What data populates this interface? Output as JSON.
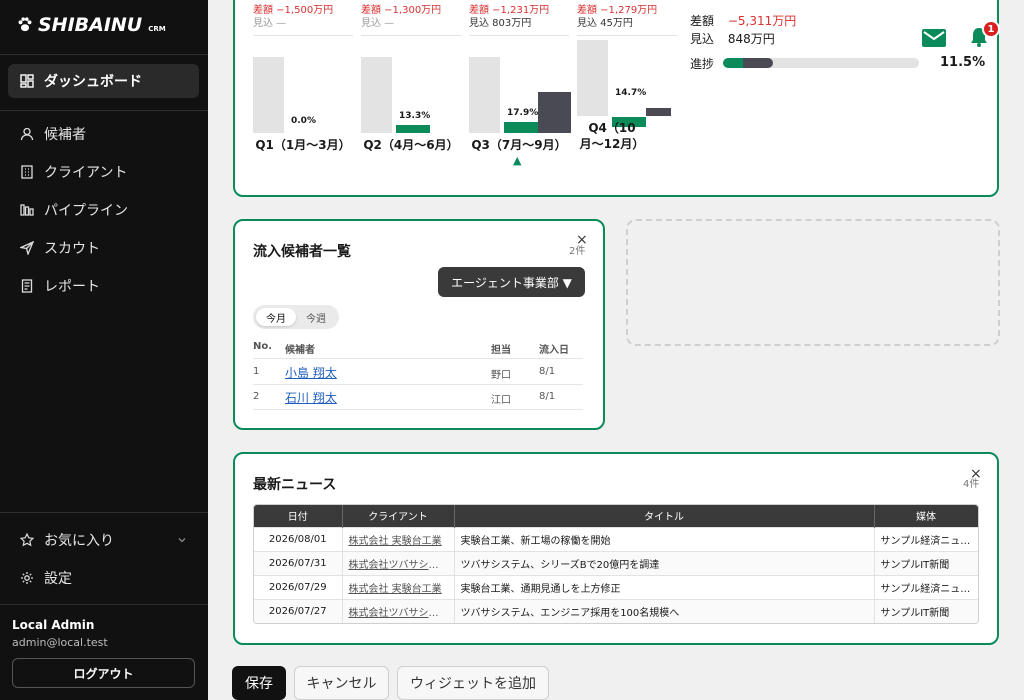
{
  "app": {
    "logo_text": "SHIBAINU",
    "logo_sub": "CRM"
  },
  "sidebar": {
    "items": [
      {
        "label": "ダッシュボード",
        "icon": "dashboard-icon",
        "active": true
      },
      {
        "label": "候補者",
        "icon": "person-icon"
      },
      {
        "label": "クライアント",
        "icon": "building-icon"
      },
      {
        "label": "パイプライン",
        "icon": "pipeline-icon"
      },
      {
        "label": "スカウト",
        "icon": "send-icon"
      },
      {
        "label": "レポート",
        "icon": "report-icon"
      }
    ],
    "favorites_label": "お気に入り",
    "settings_label": "設定",
    "user": {
      "name": "Local Admin",
      "email": "admin@local.test"
    },
    "logout_label": "ログアウト"
  },
  "sales": {
    "quarters": [
      {
        "top_red": "差額 −1,500万円",
        "forecast": "見込 —",
        "forecast_muted": true,
        "pct": "0.0%",
        "actual": 0.0,
        "has_forecast_bar": false,
        "label": "Q1（1月〜3月）",
        "current": false
      },
      {
        "top_red": "差額 −1,300万円",
        "forecast": "見込 —",
        "forecast_muted": true,
        "pct": "13.3%",
        "actual": 0.133,
        "has_forecast_bar": false,
        "label": "Q2（4月〜6月）",
        "current": false
      },
      {
        "top_red": "差額 −1,231万円",
        "forecast": "見込 803万円",
        "forecast_muted": false,
        "pct": "17.9%",
        "actual": 0.179,
        "has_forecast_bar": true,
        "label": "Q3（7月〜9月）",
        "current": true
      },
      {
        "top_red": "差額 −1,279万円",
        "forecast": "見込 45万円",
        "forecast_muted": false,
        "pct": "14.7%",
        "actual": 0.147,
        "has_forecast_bar": true,
        "label": "Q4（10月〜12月）",
        "current": false
      }
    ],
    "current_marker": "▲",
    "summary": {
      "diff_label": "差額",
      "diff_value": "−5,311万円",
      "forecast_label": "見込",
      "forecast_value": "848万円",
      "progress_label": "進捗",
      "progress_value": "11.5%",
      "progress": 0.115
    },
    "notification_count": "1",
    "colors": {
      "accent": "#0b8a5a",
      "negative": "#d93030",
      "forecast": "#4a4a55"
    }
  },
  "inflow": {
    "title": "流入候補者一覧",
    "count": "2件",
    "department": "エージェント事業部 ▼",
    "tabs": [
      "今月",
      "今週"
    ],
    "headers": [
      "No.",
      "候補者",
      "担当",
      "流入日"
    ],
    "rows": [
      {
        "no": "1",
        "name": "小島 翔太",
        "owner": "野口",
        "date": "8/1"
      },
      {
        "no": "2",
        "name": "石川 翔太",
        "owner": "江口",
        "date": "8/1"
      }
    ]
  },
  "news": {
    "title": "最新ニュース",
    "count": "4件",
    "headers": [
      "日付",
      "クライアント",
      "タイトル",
      "媒体"
    ],
    "rows": [
      {
        "date": "2026/08/01",
        "client": "株式会社 実験台工業",
        "title": "実験台工業、新工場の稼働を開始",
        "media": "サンプル経済ニュース"
      },
      {
        "date": "2026/07/31",
        "client": "株式会社ツバサシステム",
        "title": "ツバサシステム、シリーズBで20億円を調達",
        "media": "サンプルIT新聞"
      },
      {
        "date": "2026/07/29",
        "client": "株式会社 実験台工業",
        "title": "実験台工業、通期見通しを上方修正",
        "media": "サンプル経済ニュース"
      },
      {
        "date": "2026/07/27",
        "client": "株式会社ツバサシステム",
        "title": "ツバサシステム、エンジニア採用を100名規模へ",
        "media": "サンプルIT新聞"
      }
    ]
  },
  "close_symbol": "×",
  "actions": {
    "save": "保存",
    "cancel": "キャンセル",
    "add_widget": "ウィジェットを追加"
  }
}
